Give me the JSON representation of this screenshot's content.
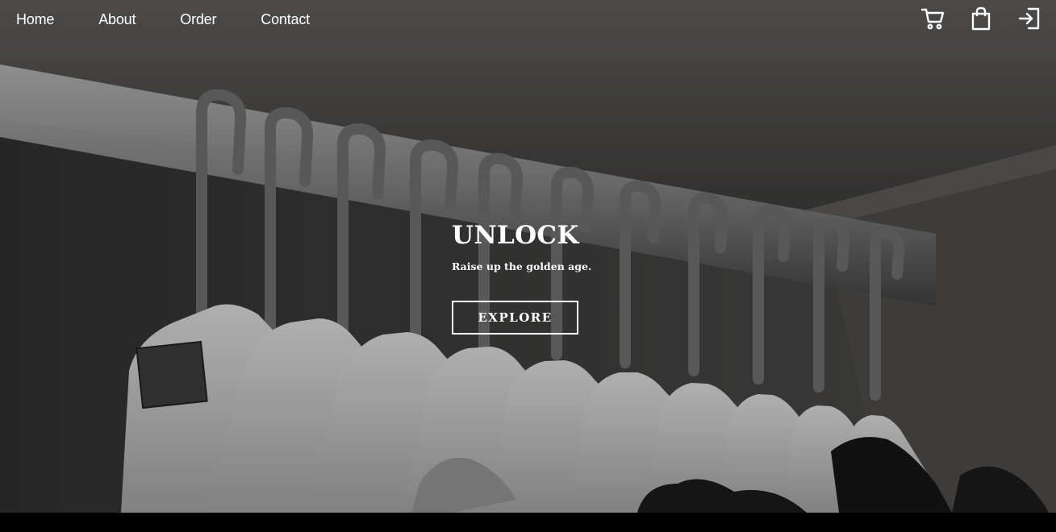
{
  "nav": {
    "items": [
      {
        "label": "Home"
      },
      {
        "label": "About"
      },
      {
        "label": "Order"
      },
      {
        "label": "Contact"
      }
    ]
  },
  "header_icons": [
    {
      "icon": "cart-icon"
    },
    {
      "icon": "shopping-bag-icon"
    },
    {
      "icon": "sign-in-icon"
    }
  ],
  "hero": {
    "headline": "UNLOCK",
    "subline": "Raise up the golden age.",
    "cta_label": "EXPLORE"
  },
  "colors": {
    "text": "#ffffff",
    "bottom_bar": "#000000",
    "hero_tone": "#3e3d3c"
  }
}
